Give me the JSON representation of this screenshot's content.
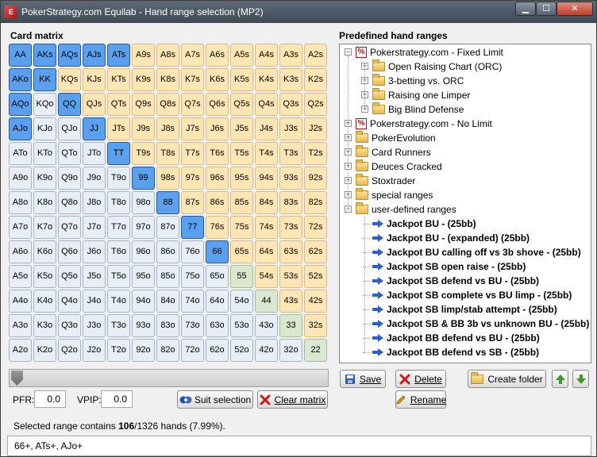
{
  "window": {
    "title": "PokerStrategy.com Equilab - Hand range selection (MP2)",
    "min": "▁",
    "max": "☐",
    "close": "✕"
  },
  "matrix": {
    "label": "Card matrix",
    "rows": [
      [
        "AA",
        "AKs",
        "AQs",
        "AJs",
        "ATs",
        "A9s",
        "A8s",
        "A7s",
        "A6s",
        "A5s",
        "A4s",
        "A3s",
        "A2s"
      ],
      [
        "AKo",
        "KK",
        "KQs",
        "KJs",
        "KTs",
        "K9s",
        "K8s",
        "K7s",
        "K6s",
        "K5s",
        "K4s",
        "K3s",
        "K2s"
      ],
      [
        "AQo",
        "KQo",
        "QQ",
        "QJs",
        "QTs",
        "Q9s",
        "Q8s",
        "Q7s",
        "Q6s",
        "Q5s",
        "Q4s",
        "Q3s",
        "Q2s"
      ],
      [
        "AJo",
        "KJo",
        "QJo",
        "JJ",
        "JTs",
        "J9s",
        "J8s",
        "J7s",
        "J6s",
        "J5s",
        "J4s",
        "J3s",
        "J2s"
      ],
      [
        "ATo",
        "KTo",
        "QTo",
        "JTo",
        "TT",
        "T9s",
        "T8s",
        "T7s",
        "T6s",
        "T5s",
        "T4s",
        "T3s",
        "T2s"
      ],
      [
        "A9o",
        "K9o",
        "Q9o",
        "J9o",
        "T9o",
        "99",
        "98s",
        "97s",
        "96s",
        "95s",
        "94s",
        "93s",
        "92s"
      ],
      [
        "A8o",
        "K8o",
        "Q8o",
        "J8o",
        "T8o",
        "98o",
        "88",
        "87s",
        "86s",
        "85s",
        "84s",
        "83s",
        "82s"
      ],
      [
        "A7o",
        "K7o",
        "Q7o",
        "J7o",
        "T7o",
        "97o",
        "87o",
        "77",
        "76s",
        "75s",
        "74s",
        "73s",
        "72s"
      ],
      [
        "A6o",
        "K6o",
        "Q6o",
        "J6o",
        "T6o",
        "96o",
        "86o",
        "76o",
        "66",
        "65s",
        "64s",
        "63s",
        "62s"
      ],
      [
        "A5o",
        "K5o",
        "Q5o",
        "J5o",
        "T5o",
        "95o",
        "85o",
        "75o",
        "65o",
        "55",
        "54s",
        "53s",
        "52s"
      ],
      [
        "A4o",
        "K4o",
        "Q4o",
        "J4o",
        "T4o",
        "94o",
        "84o",
        "74o",
        "64o",
        "54o",
        "44",
        "43s",
        "42s"
      ],
      [
        "A3o",
        "K3o",
        "Q3o",
        "J3o",
        "T3o",
        "93o",
        "83o",
        "73o",
        "63o",
        "53o",
        "43o",
        "33",
        "32s"
      ],
      [
        "A2o",
        "K2o",
        "Q2o",
        "J2o",
        "T2o",
        "92o",
        "82o",
        "72o",
        "62o",
        "52o",
        "42o",
        "32o",
        "22"
      ]
    ],
    "selected": [
      "AA",
      "AKs",
      "AQs",
      "AJs",
      "ATs",
      "AKo",
      "KK",
      "AQo",
      "QQ",
      "AJo",
      "JJ",
      "TT",
      "99",
      "88",
      "77",
      "66"
    ]
  },
  "slider": {
    "value": 0
  },
  "pfr": {
    "label": "PFR:",
    "value": "0.0"
  },
  "vpip": {
    "label": "VPIP:",
    "value": "0.0"
  },
  "buttons": {
    "suit_selection": "Suit selection",
    "clear_matrix": "Clear matrix",
    "save": "Save",
    "delete": "Delete",
    "create_folder": "Create folder",
    "rename": "Rename"
  },
  "summary": {
    "prefix": "Selected range contains ",
    "hands": "106",
    "suffix": "/1326 hands (7.99%)."
  },
  "range_text": "66+, ATs+, AJo+",
  "predefined": {
    "label": "Predefined hand ranges",
    "items": [
      {
        "text": "Pokerstrategy.com - Fixed Limit",
        "icon": "pokerstrategy-icon",
        "level": 0,
        "exp": "−",
        "bold": false
      },
      {
        "text": "Open Raising Chart (ORC)",
        "icon": "folder-icon",
        "level": 1,
        "exp": "+",
        "bold": false
      },
      {
        "text": "3-betting vs. ORC",
        "icon": "folder-icon",
        "level": 1,
        "exp": "+",
        "bold": false
      },
      {
        "text": "Raising one Limper",
        "icon": "folder-icon",
        "level": 1,
        "exp": "+",
        "bold": false
      },
      {
        "text": "Big Blind Defense",
        "icon": "folder-icon",
        "level": 1,
        "exp": "+",
        "bold": false
      },
      {
        "text": "Pokerstrategy.com - No Limit",
        "icon": "pokerstrategy-icon",
        "level": 0,
        "exp": "+",
        "bold": false
      },
      {
        "text": "PokerEvolution",
        "icon": "folder-icon",
        "level": 0,
        "exp": "+",
        "bold": false
      },
      {
        "text": "Card Runners",
        "icon": "folder-icon",
        "level": 0,
        "exp": "+",
        "bold": false
      },
      {
        "text": "Deuces Cracked",
        "icon": "folder-icon",
        "level": 0,
        "exp": "+",
        "bold": false
      },
      {
        "text": "Stoxtrader",
        "icon": "folder-icon",
        "level": 0,
        "exp": "+",
        "bold": false
      },
      {
        "text": "special ranges",
        "icon": "folder-icon",
        "level": 0,
        "exp": "+",
        "bold": false
      },
      {
        "text": "user-defined ranges",
        "icon": "folder-open-icon",
        "level": 0,
        "exp": "−",
        "bold": false
      },
      {
        "text": "Jackpot BU - (25bb)",
        "icon": "range-arrow-icon",
        "level": 1,
        "exp": "",
        "bold": true
      },
      {
        "text": "Jackpot BU - (expanded) (25bb)",
        "icon": "range-arrow-icon",
        "level": 1,
        "exp": "",
        "bold": true
      },
      {
        "text": "Jackpot BU calling off vs 3b shove - (25bb)",
        "icon": "range-arrow-icon",
        "level": 1,
        "exp": "",
        "bold": true
      },
      {
        "text": "Jackpot SB open raise - (25bb)",
        "icon": "range-arrow-icon",
        "level": 1,
        "exp": "",
        "bold": true
      },
      {
        "text": "Jackpot SB defend vs BU - (25bb)",
        "icon": "range-arrow-icon",
        "level": 1,
        "exp": "",
        "bold": true
      },
      {
        "text": "Jackpot SB complete vs BU limp - (25bb)",
        "icon": "range-arrow-icon",
        "level": 1,
        "exp": "",
        "bold": true
      },
      {
        "text": "Jackpot SB limp/stab attempt - (25bb)",
        "icon": "range-arrow-icon",
        "level": 1,
        "exp": "",
        "bold": true
      },
      {
        "text": "Jackpot SB & BB 3b vs unknown BU - (25bb)",
        "icon": "range-arrow-icon",
        "level": 1,
        "exp": "",
        "bold": true
      },
      {
        "text": "Jackpot BB defend vs BU - (25bb)",
        "icon": "range-arrow-icon",
        "level": 1,
        "exp": "",
        "bold": true
      },
      {
        "text": "Jackpot BB defend vs SB - (25bb)",
        "icon": "range-arrow-icon",
        "level": 1,
        "exp": "",
        "bold": true
      }
    ]
  },
  "colors": {
    "selected": "#5aa0ee",
    "suited": "#fde6b4",
    "offsuit": "#e7eef6",
    "pair": "#dbe8d0"
  }
}
